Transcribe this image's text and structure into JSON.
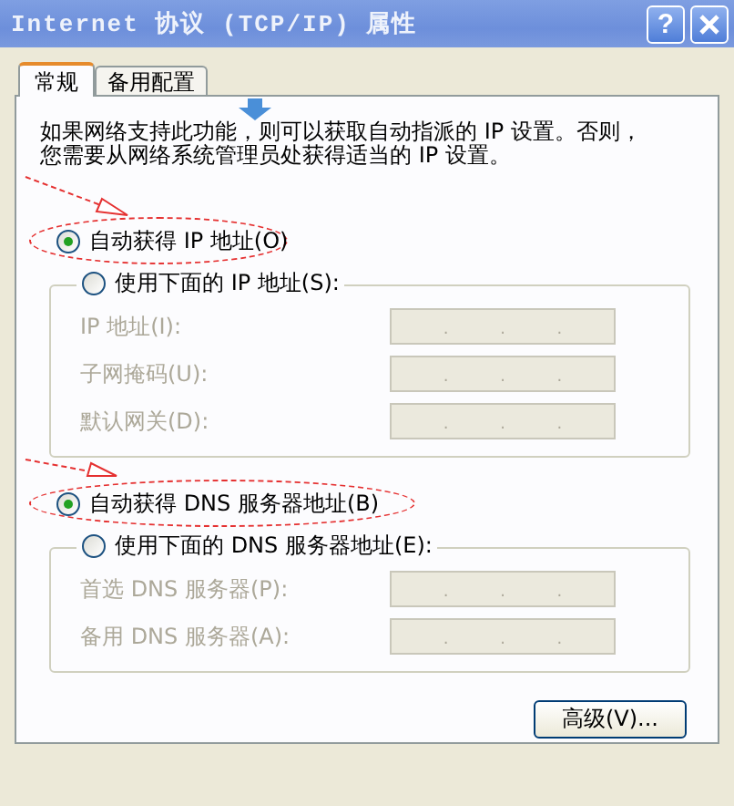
{
  "window": {
    "title": "Internet 协议 (TCP/IP) 属性",
    "help_button": "?"
  },
  "tabs": [
    {
      "label": "常规",
      "selected": true
    },
    {
      "label": "备用配置",
      "selected": false
    }
  ],
  "description": "如果网络支持此功能，则可以获取自动指派的 IP 设置。否则，您需要从网络系统管理员处获得适当的 IP 设置。",
  "ip_section": {
    "auto_option": {
      "label": "自动获得 IP 地址(O)",
      "selected": true
    },
    "manual_option": {
      "label": "使用下面的 IP 地址(S):",
      "selected": false
    },
    "fields": [
      {
        "label": "IP 地址(I):",
        "separator": ".",
        "disabled": true
      },
      {
        "label": "子网掩码(U):",
        "separator": ".",
        "disabled": true
      },
      {
        "label": "默认网关(D):",
        "separator": ".",
        "disabled": true
      }
    ]
  },
  "dns_section": {
    "auto_option": {
      "label": "自动获得 DNS 服务器地址(B)",
      "selected": true
    },
    "manual_option": {
      "label": "使用下面的 DNS 服务器地址(E):",
      "selected": false
    },
    "fields": [
      {
        "label": "首选 DNS 服务器(P):",
        "separator": ".",
        "disabled": true
      },
      {
        "label": "备用 DNS 服务器(A):",
        "separator": ".",
        "disabled": true
      }
    ]
  },
  "advanced_button": "高级(V)..."
}
